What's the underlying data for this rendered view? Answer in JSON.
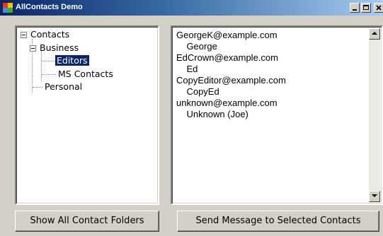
{
  "window": {
    "title": "AllContacts Demo",
    "icon": "app-icon"
  },
  "tree": {
    "root": "Contacts",
    "business": "Business",
    "editors": "Editors",
    "ms_contacts": "MS Contacts",
    "personal": "Personal",
    "selected_item": "Editors"
  },
  "contacts_text": {
    "lines": [
      "GeorgeK@example.com",
      "    George",
      "EdCrown@example.com",
      "    Ed",
      "CopyEditor@example.com",
      "    CopyEd",
      "unknown@example.com",
      "    Unknown (Joe)"
    ]
  },
  "buttons": {
    "show_all": "Show All Contact Folders",
    "send": "Send Message to Selected Contacts"
  },
  "colors": {
    "titlebar_start": "#0a246a",
    "titlebar_end": "#a6caf0",
    "selection": "#0a246a",
    "face": "#d4d0c8"
  }
}
